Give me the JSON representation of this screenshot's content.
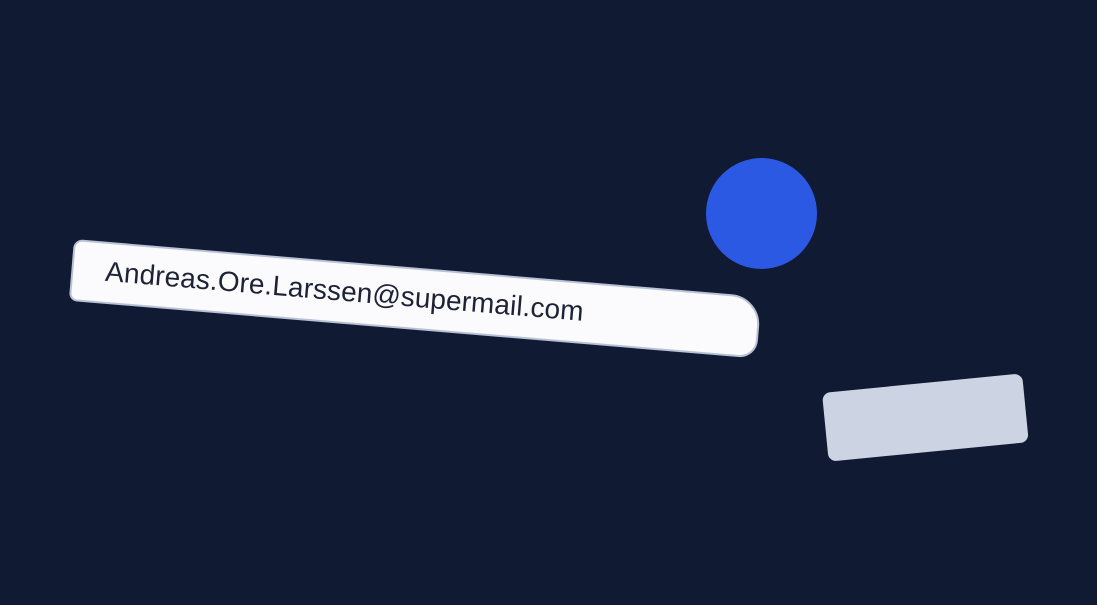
{
  "email_input": {
    "value": "Andreas.Ore.Larssen@supermail.com"
  },
  "colors": {
    "background": "#111a33",
    "field_fill": "#fbfbfd",
    "field_border": "#b8c2d6",
    "blue_dot": "#2c59e3",
    "gray_pill": "#ccd3e2",
    "text": "#1d2238"
  }
}
